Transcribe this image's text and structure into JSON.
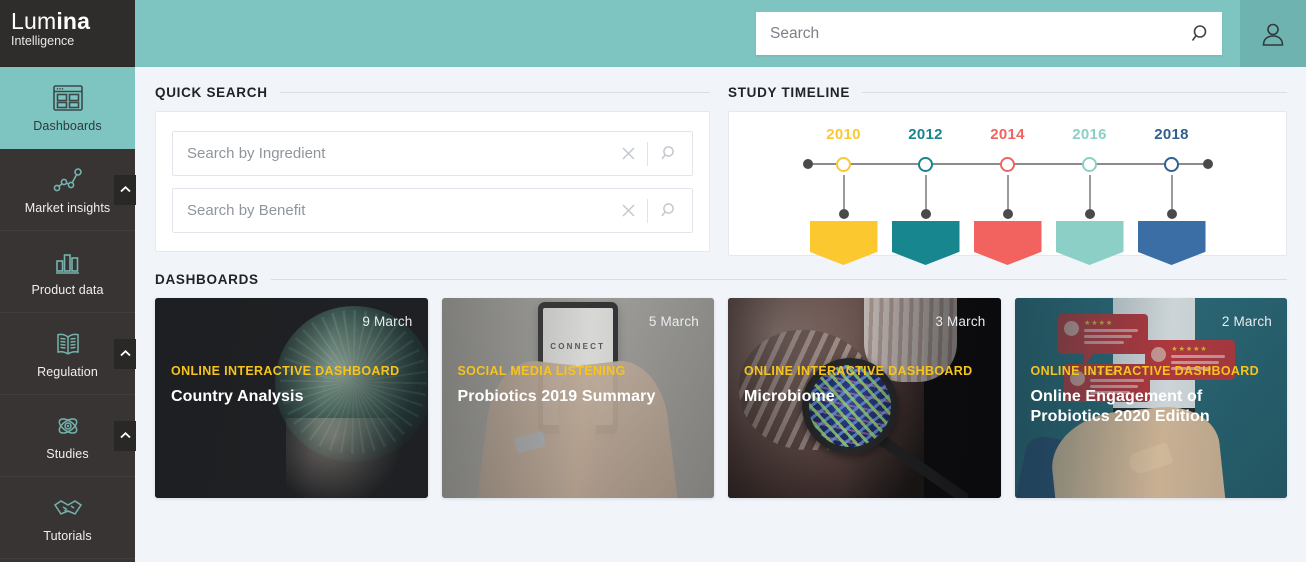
{
  "brand": {
    "name_thin": "Lum",
    "name_bold": "ina",
    "subtitle": "Intelligence"
  },
  "colors": {
    "header_teal": "#7ec4c1",
    "sidebar_dark": "#373433",
    "accent_yellow": "#f6c31f",
    "page_bg": "#f1f5fa"
  },
  "sidebar": {
    "items": [
      {
        "label": "Dashboards",
        "icon": "dashboard-grid-icon",
        "active": true,
        "chevron": false
      },
      {
        "label": "Market insights",
        "icon": "line-chart-icon",
        "active": false,
        "chevron": true
      },
      {
        "label": "Product data",
        "icon": "bar-chart-icon",
        "active": false,
        "chevron": false
      },
      {
        "label": "Regulation",
        "icon": "open-book-icon",
        "active": false,
        "chevron": true
      },
      {
        "label": "Studies",
        "icon": "atom-icon",
        "active": false,
        "chevron": true
      },
      {
        "label": "Tutorials",
        "icon": "handshake-icon",
        "active": false,
        "chevron": false
      }
    ]
  },
  "header": {
    "search": {
      "placeholder": "Search",
      "value": "",
      "icon": "search-icon"
    },
    "user": {
      "icon": "user-avatar-icon"
    }
  },
  "quick_search": {
    "section_label": "QUICK SEARCH",
    "fields": [
      {
        "placeholder": "Search by Ingredient",
        "value": "",
        "clear_icon": "close-icon",
        "search_icon": "search-icon"
      },
      {
        "placeholder": "Search by Benefit",
        "value": "",
        "clear_icon": "close-icon",
        "search_icon": "search-icon"
      }
    ]
  },
  "study_timeline": {
    "section_label": "STUDY TIMELINE",
    "chart_data": {
      "type": "timeline",
      "title": "STUDY TIMELINE",
      "categories": [
        "2010",
        "2012",
        "2014",
        "2016",
        "2018"
      ],
      "points": [
        {
          "year": "2010",
          "color": "#fcc830"
        },
        {
          "year": "2012",
          "color": "#17868f"
        },
        {
          "year": "2014",
          "color": "#f2635f"
        },
        {
          "year": "2016",
          "color": "#8bcfc6"
        },
        {
          "year": "2018",
          "color": "#3a6ea5"
        }
      ]
    }
  },
  "dashboards": {
    "section_label": "DASHBOARDS",
    "cards": [
      {
        "date": "9 March",
        "kicker": "ONLINE INTERACTIVE DASHBOARD",
        "title": "Country Analysis",
        "art": "globe-in-hand-image"
      },
      {
        "date": "5 March",
        "kicker": "SOCIAL MEDIA LISTENING",
        "title": "Probiotics 2019 Summary",
        "art": "tablet-connect-image",
        "art_caption": "CONNECT"
      },
      {
        "date": "3 March",
        "kicker": "ONLINE INTERACTIVE DASHBOARD",
        "title": "Microbiome",
        "art": "gut-magnifier-bacteria-image"
      },
      {
        "date": "2 March",
        "kicker": "ONLINE INTERACTIVE DASHBOARD",
        "title": "Online Engagement of Probiotics 2020 Edition",
        "art": "phone-reviews-illustration"
      }
    ]
  }
}
